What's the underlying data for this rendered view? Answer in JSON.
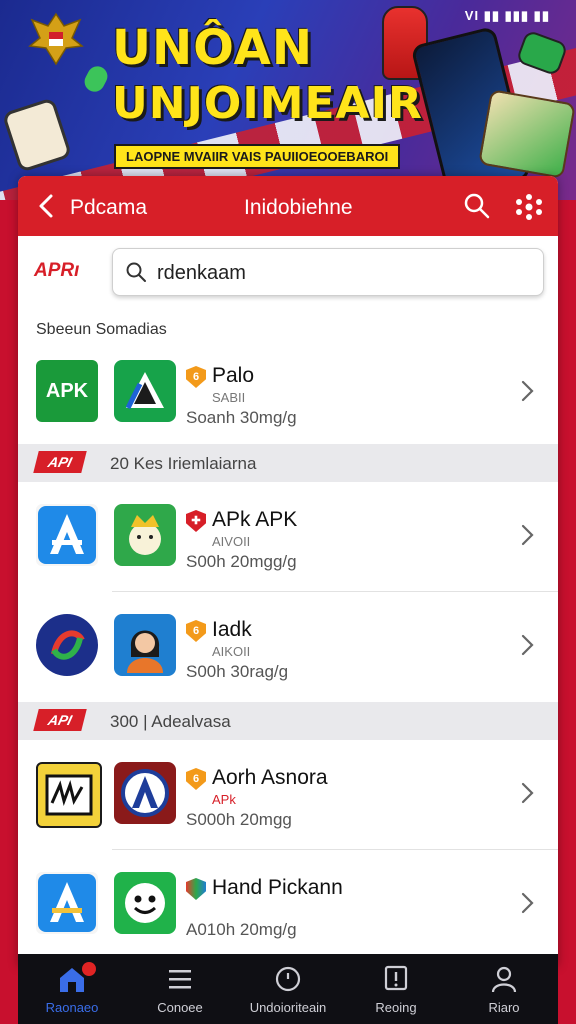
{
  "status_bar": {
    "text": "VI ▮▮ ▮▮▮ ▮▮"
  },
  "banner": {
    "title_line1": "UNÔAN",
    "title_line2": "UNJOIMEAIR",
    "tagline": "LAOPNE MVAIIR VAIS PAUIIOEOOEBAROI"
  },
  "appbar": {
    "breadcrumb": "Pdcama",
    "title": "Inidobiehne"
  },
  "search": {
    "logo": "APRı",
    "value": "rdenkaam"
  },
  "sections": {
    "first": "Sbeeun Somadias",
    "second": {
      "tag": "API",
      "label": "20 Kes Iriemlaiarna"
    },
    "third": {
      "tag": "API",
      "label": "300 | Adealvasa"
    }
  },
  "apps": [
    {
      "name": "Palo",
      "sub": "SABII",
      "size": "Soanh 30mg/g",
      "icon_a_label": "APK",
      "icon_a_color": "#1a9a3a",
      "badge": "shield"
    },
    {
      "name": "APk APK",
      "sub": "AIVOII",
      "size": "S00h 20mgg/g",
      "icon_a_label": "A",
      "icon_a_color": "#f5f5f5",
      "badge": "apk"
    },
    {
      "name": "Iadk",
      "sub": "AIKOII",
      "size": "S00h 30rag/g",
      "icon_a_label": "",
      "icon_a_color": "#1c2f8a",
      "badge": "shield"
    },
    {
      "name": "Aorh Asnora",
      "sub": "APk",
      "size": "S000h 20mgg",
      "icon_a_label": "",
      "icon_a_color": "#f3d23a",
      "badge": "shield"
    },
    {
      "name": "Hand Pickann",
      "sub": "",
      "size": "A010h 20mg/g",
      "icon_a_label": "A",
      "icon_a_color": "#f5f5f5",
      "badge": "apk"
    }
  ],
  "bottom_nav": [
    {
      "label": "Raonaeo",
      "icon": "home-icon",
      "active": true
    },
    {
      "label": "Conoee",
      "icon": "menu-icon",
      "active": false
    },
    {
      "label": "Undoioriteain",
      "icon": "clock-icon",
      "active": false
    },
    {
      "label": "Reoing",
      "icon": "alert-icon",
      "active": false
    },
    {
      "label": "Riaro",
      "icon": "user-icon",
      "active": false
    }
  ],
  "colors": {
    "accent": "#d71f28",
    "banner_yellow": "#ffe41a",
    "nav_active": "#3a6de8"
  }
}
